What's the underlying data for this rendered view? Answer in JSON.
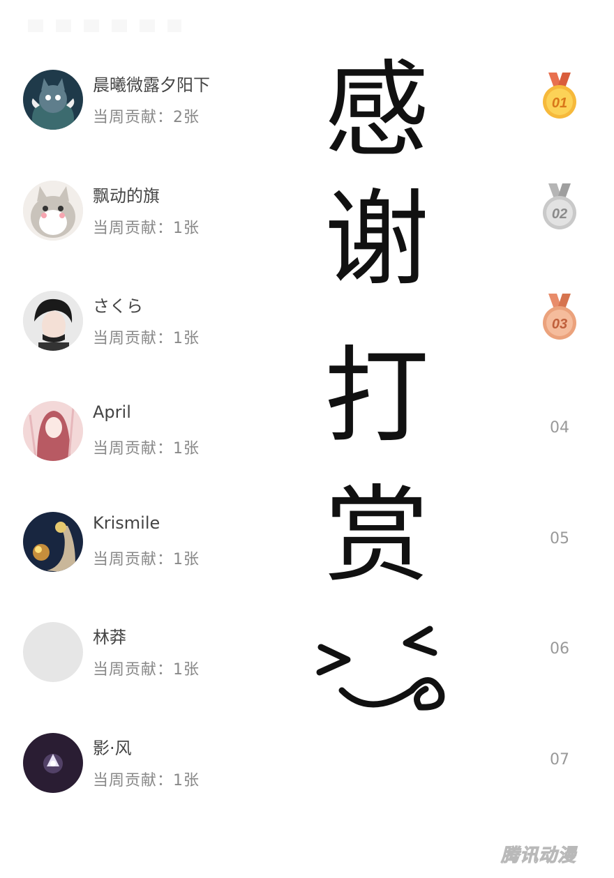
{
  "thanks_text": "感谢打赏",
  "brand": "腾讯动漫",
  "medal_colors": {
    "gold": "#f6b93b",
    "silver": "#c9c9c9",
    "bronze": "#eba27c",
    "ribbon": "#e8704f"
  },
  "supporters": [
    {
      "name": "晨曦微露夕阳下",
      "contribution": "当周贡献：2张",
      "rank": "01",
      "medal": "gold"
    },
    {
      "name": "飘动的旗",
      "contribution": "当周贡献：1张",
      "rank": "02",
      "medal": "silver"
    },
    {
      "name": "さくら",
      "contribution": "当周贡献：1张",
      "rank": "03",
      "medal": "bronze"
    },
    {
      "name": "April",
      "contribution": "当周贡献：1张",
      "rank": "04",
      "medal": ""
    },
    {
      "name": "Krismile",
      "contribution": "当周贡献：1张",
      "rank": "05",
      "medal": ""
    },
    {
      "name": "林莽",
      "contribution": "当周贡献：1张",
      "rank": "06",
      "medal": ""
    },
    {
      "name": "影·风",
      "contribution": "当周贡献：1张",
      "rank": "07",
      "medal": ""
    }
  ]
}
